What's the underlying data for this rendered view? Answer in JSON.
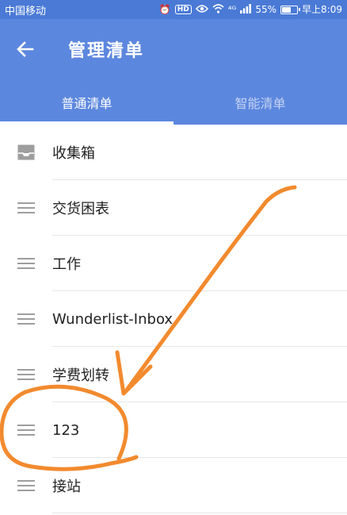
{
  "status_bar": {
    "carrier": "中国移动",
    "network": "⁴ᴳ",
    "battery": "55%",
    "battery_level": 0.55,
    "time": "早上8:09",
    "hd": "HD"
  },
  "app_bar": {
    "title": "管理清单",
    "back_icon": "arrow-left-icon"
  },
  "tabs": [
    {
      "label": "普通清单",
      "active": true
    },
    {
      "label": "智能清单",
      "active": false
    }
  ],
  "lists": [
    {
      "label": "收集箱",
      "icon": "inbox-icon"
    },
    {
      "label": "交货困表",
      "icon": "drag-handle-icon"
    },
    {
      "label": "工作",
      "icon": "drag-handle-icon"
    },
    {
      "label": "Wunderlist-Inbox",
      "icon": "drag-handle-icon"
    },
    {
      "label": "学费划转",
      "icon": "drag-handle-icon"
    },
    {
      "label": "123",
      "icon": "drag-handle-icon"
    },
    {
      "label": "接站",
      "icon": "drag-handle-icon"
    }
  ],
  "colors": {
    "app_bar": "#5c87de",
    "status_bar": "#4a7ad6",
    "annotation": "#f28a2e",
    "icon_gray": "#9e9e9e"
  }
}
